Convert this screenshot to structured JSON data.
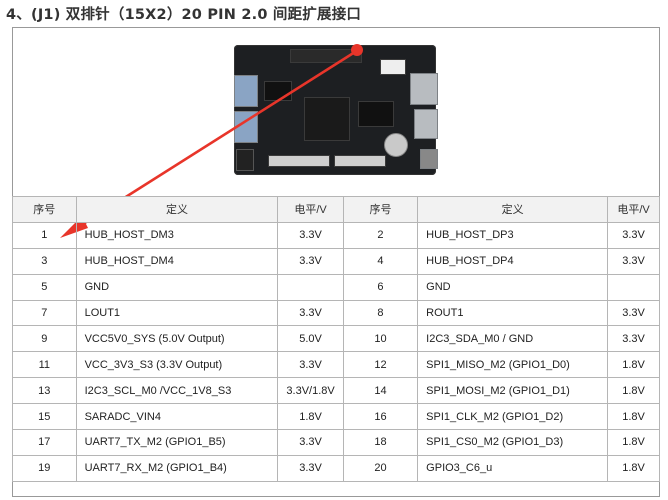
{
  "title": "4、(J1) 双排针（15X2）20 PIN 2.0 间距扩展接口",
  "table": {
    "headers": [
      "序号",
      "定义",
      "电平/V",
      "序号",
      "定义",
      "电平/V"
    ],
    "rows": [
      {
        "n1": "1",
        "d1": "HUB_HOST_DM3",
        "v1": "3.3V",
        "n2": "2",
        "d2": "HUB_HOST_DP3",
        "v2": "3.3V"
      },
      {
        "n1": "3",
        "d1": "HUB_HOST_DM4",
        "v1": "3.3V",
        "n2": "4",
        "d2": "HUB_HOST_DP4",
        "v2": "3.3V"
      },
      {
        "n1": "5",
        "d1": "GND",
        "v1": "",
        "n2": "6",
        "d2": "GND",
        "v2": ""
      },
      {
        "n1": "7",
        "d1": "LOUT1",
        "v1": "3.3V",
        "n2": "8",
        "d2": "ROUT1",
        "v2": "3.3V"
      },
      {
        "n1": "9",
        "d1": "VCC5V0_SYS (5.0V Output)",
        "v1": "5.0V",
        "n2": "10",
        "d2": "I2C3_SDA_M0 / GND",
        "v2": "3.3V"
      },
      {
        "n1": "11",
        "d1": "VCC_3V3_S3 (3.3V Output)",
        "v1": "3.3V",
        "n2": "12",
        "d2": "SPI1_MISO_M2 (GPIO1_D0)",
        "v2": "1.8V"
      },
      {
        "n1": "13",
        "d1": "I2C3_SCL_M0 /VCC_1V8_S3",
        "v1": "3.3V/1.8V",
        "n2": "14",
        "d2": "SPI1_MOSI_M2 (GPIO1_D1)",
        "v2": "1.8V"
      },
      {
        "n1": "15",
        "d1": "SARADC_VIN4",
        "v1": "1.8V",
        "n2": "16",
        "d2": "SPI1_CLK_M2 (GPIO1_D2)",
        "v2": "1.8V"
      },
      {
        "n1": "17",
        "d1": "UART7_TX_M2 (GPIO1_B5)",
        "v1": "3.3V",
        "n2": "18",
        "d2": "SPI1_CS0_M2 (GPIO1_D3)",
        "v2": "1.8V"
      },
      {
        "n1": "19",
        "d1": "UART7_RX_M2 (GPIO1_B4)",
        "v1": "3.3V",
        "n2": "20",
        "d2": "GPIO3_C6_u",
        "v2": "1.8V"
      }
    ]
  },
  "colors": {
    "arrow": "#e8352a",
    "marker": "#e8352a",
    "board": "#1d1f22"
  }
}
